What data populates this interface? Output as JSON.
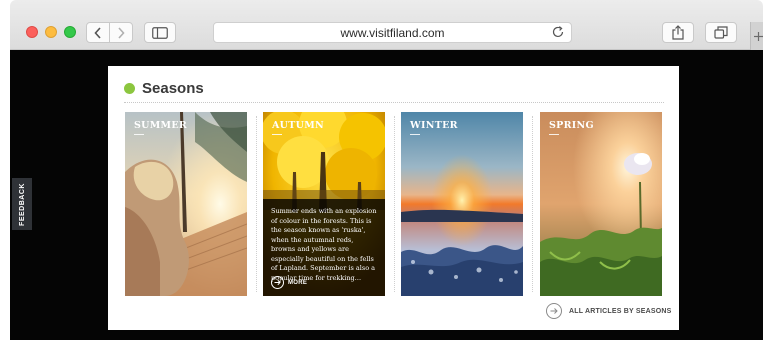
{
  "browser": {
    "url": "www.visitfiland.com",
    "icons": {
      "back": "chevron-left-icon",
      "forward": "chevron-right-icon",
      "sidebar": "sidebar-icon",
      "reload": "reload-icon",
      "share": "share-icon",
      "tabs": "tabs-overview-icon",
      "new_tab": "plus-icon"
    }
  },
  "feedback": {
    "label": "FEEDBACK"
  },
  "section": {
    "title": "Seasons",
    "accent_color": "#8cc63f"
  },
  "seasons": [
    {
      "label": "SUMMER"
    },
    {
      "label": "AUTUMN",
      "description": "Summer ends with an explosion of colour in the forests. This is the season known as 'ruska', when the autumnal reds, browns and yellows are especially beautiful on the fells of Lapland. September is also a popular time for trekking…",
      "more_label": "MORE"
    },
    {
      "label": "WINTER"
    },
    {
      "label": "SPRING"
    }
  ],
  "all_articles": {
    "label": "ALL ARTICLES BY SEASONS"
  }
}
